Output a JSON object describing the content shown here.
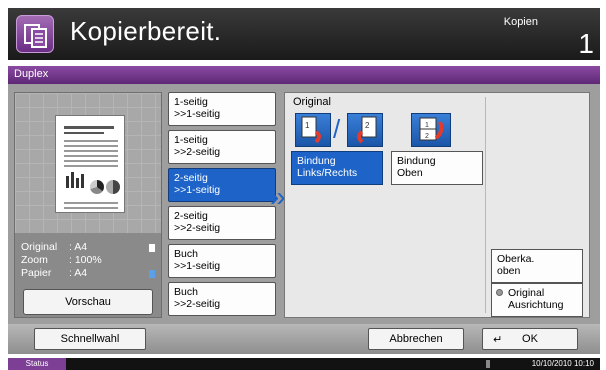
{
  "header": {
    "title": "Kopierbereit.",
    "copies_label": "Kopien",
    "copies_count": "1"
  },
  "function_title": "Duplex",
  "preview": {
    "rows": [
      {
        "key": "Original",
        "value": ": A4"
      },
      {
        "key": "Zoom",
        "value": ": 100%"
      },
      {
        "key": "Papier",
        "value": ": A4"
      }
    ],
    "button_label": "Vorschau"
  },
  "modes": [
    {
      "line1": "1-seitig",
      "line2": ">>1-seitig"
    },
    {
      "line1": "1-seitig",
      "line2": ">>2-seitig"
    },
    {
      "line1": "2-seitig",
      "line2": ">>1-seitig"
    },
    {
      "line1": "2-seitig",
      "line2": ">>2-seitig"
    },
    {
      "line1": "Buch",
      "line2": ">>1-seitig"
    },
    {
      "line1": "Buch",
      "line2": ">>2-seitig"
    }
  ],
  "selected_mode_index": 2,
  "original": {
    "label": "Original",
    "bindung_lr": {
      "line1": "Bindung",
      "line2": "Links/Rechts"
    },
    "bindung_oben": {
      "line1": "Bindung",
      "line2": "Oben"
    },
    "top_edge": {
      "line1": "Oberka.",
      "line2": "oben"
    },
    "orientation": {
      "line1": "Original",
      "line2": "Ausrichtung"
    }
  },
  "bottom": {
    "quick": "Schnellwahl",
    "cancel": "Abbrechen",
    "ok": "OK"
  },
  "status": {
    "tab": "Status",
    "datetime": "10/10/2010  10:10"
  },
  "colors": {
    "accent_purple": "#6a2d85",
    "selected_blue": "#1e64c8"
  }
}
